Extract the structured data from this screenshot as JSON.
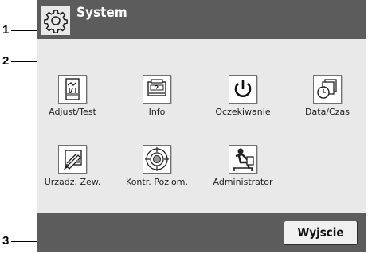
{
  "callouts": [
    "1",
    "2",
    "3"
  ],
  "header": {
    "title": "System",
    "icon": "gear-icon"
  },
  "tiles": [
    {
      "label": "Adjust/Test",
      "icon": "adjust-test-icon"
    },
    {
      "label": "Info",
      "icon": "info-icon"
    },
    {
      "label": "Oczekiwanie",
      "icon": "power-icon"
    },
    {
      "label": "Data/Czas",
      "icon": "calendar-clock-icon"
    },
    {
      "label": "Urzadz. Zew.",
      "icon": "device-icon"
    },
    {
      "label": "Kontr. Poziom.",
      "icon": "level-target-icon"
    },
    {
      "label": "Administrator",
      "icon": "administrator-icon"
    }
  ],
  "footer": {
    "exit_label": "Wyjscie"
  },
  "colors": {
    "bar": "#5c5c5c",
    "panel": "#e9e9e9",
    "button": "#f0f0f0"
  }
}
